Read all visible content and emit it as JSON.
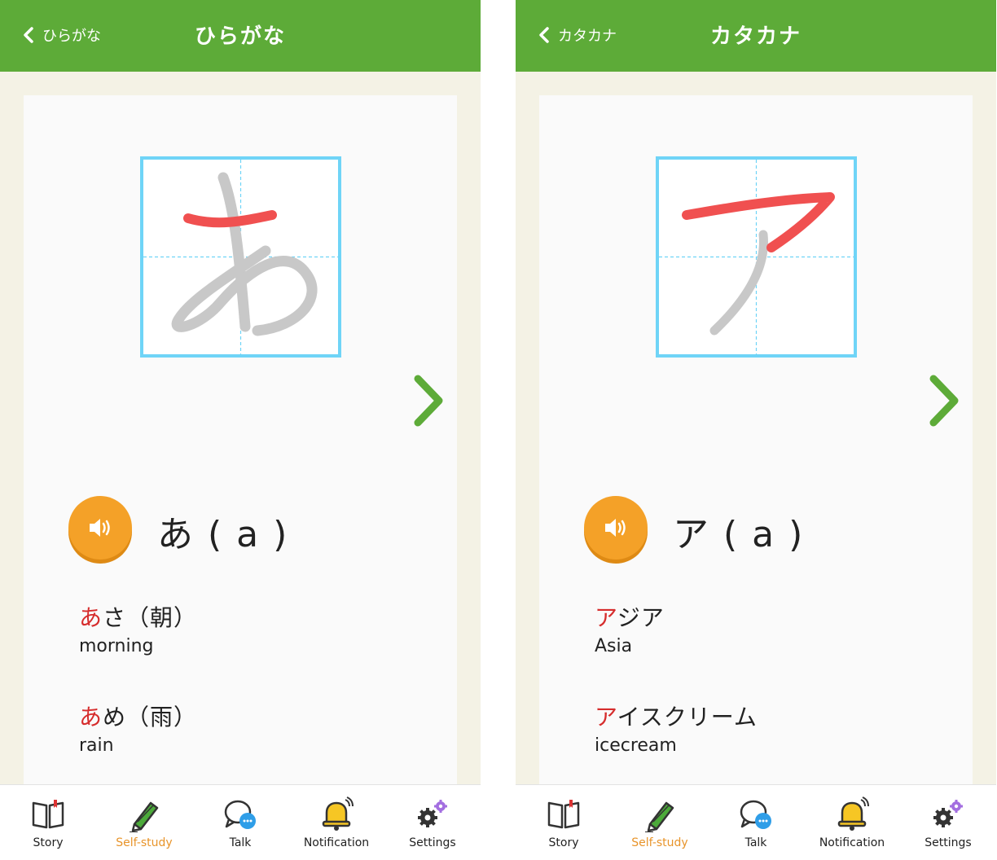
{
  "colors": {
    "header": "#5dab38",
    "accent_next": "#5dab38",
    "grid_border": "#6fd4f7",
    "stroke_active": "#f05050",
    "stroke_inactive": "#c8c8c8",
    "highlight_text": "#d62d2d",
    "sound_button": "#f4a128",
    "tab_active": "#e8942a"
  },
  "screens": [
    {
      "header": {
        "back_label": "ひらがな",
        "title": "ひらがな"
      },
      "character": "あ",
      "reading_label": "あ ( a )",
      "words": [
        {
          "hl": "あ",
          "rest": "さ（朝）",
          "meaning": "morning"
        },
        {
          "hl": "あ",
          "rest": "め（雨）",
          "meaning": "rain"
        }
      ],
      "icons": {
        "back": "chevron-left-icon",
        "next": "chevron-right-icon",
        "sound": "speaker-icon"
      }
    },
    {
      "header": {
        "back_label": "カタカナ",
        "title": "カタカナ"
      },
      "character": "ア",
      "reading_label": "ア ( a )",
      "words": [
        {
          "hl": "ア",
          "rest": "ジア",
          "meaning": "Asia"
        },
        {
          "hl": "ア",
          "rest": "イスクリーム",
          "meaning": "icecream"
        }
      ],
      "icons": {
        "back": "chevron-left-icon",
        "next": "chevron-right-icon",
        "sound": "speaker-icon"
      }
    }
  ],
  "tabbar": {
    "active": "Self-study",
    "items": [
      {
        "label": "Story",
        "icon": "book-icon"
      },
      {
        "label": "Self-study",
        "icon": "pencil-icon"
      },
      {
        "label": "Talk",
        "icon": "chat-bubble-icon"
      },
      {
        "label": "Notification",
        "icon": "bell-icon"
      },
      {
        "label": "Settings",
        "icon": "gears-icon"
      }
    ]
  }
}
